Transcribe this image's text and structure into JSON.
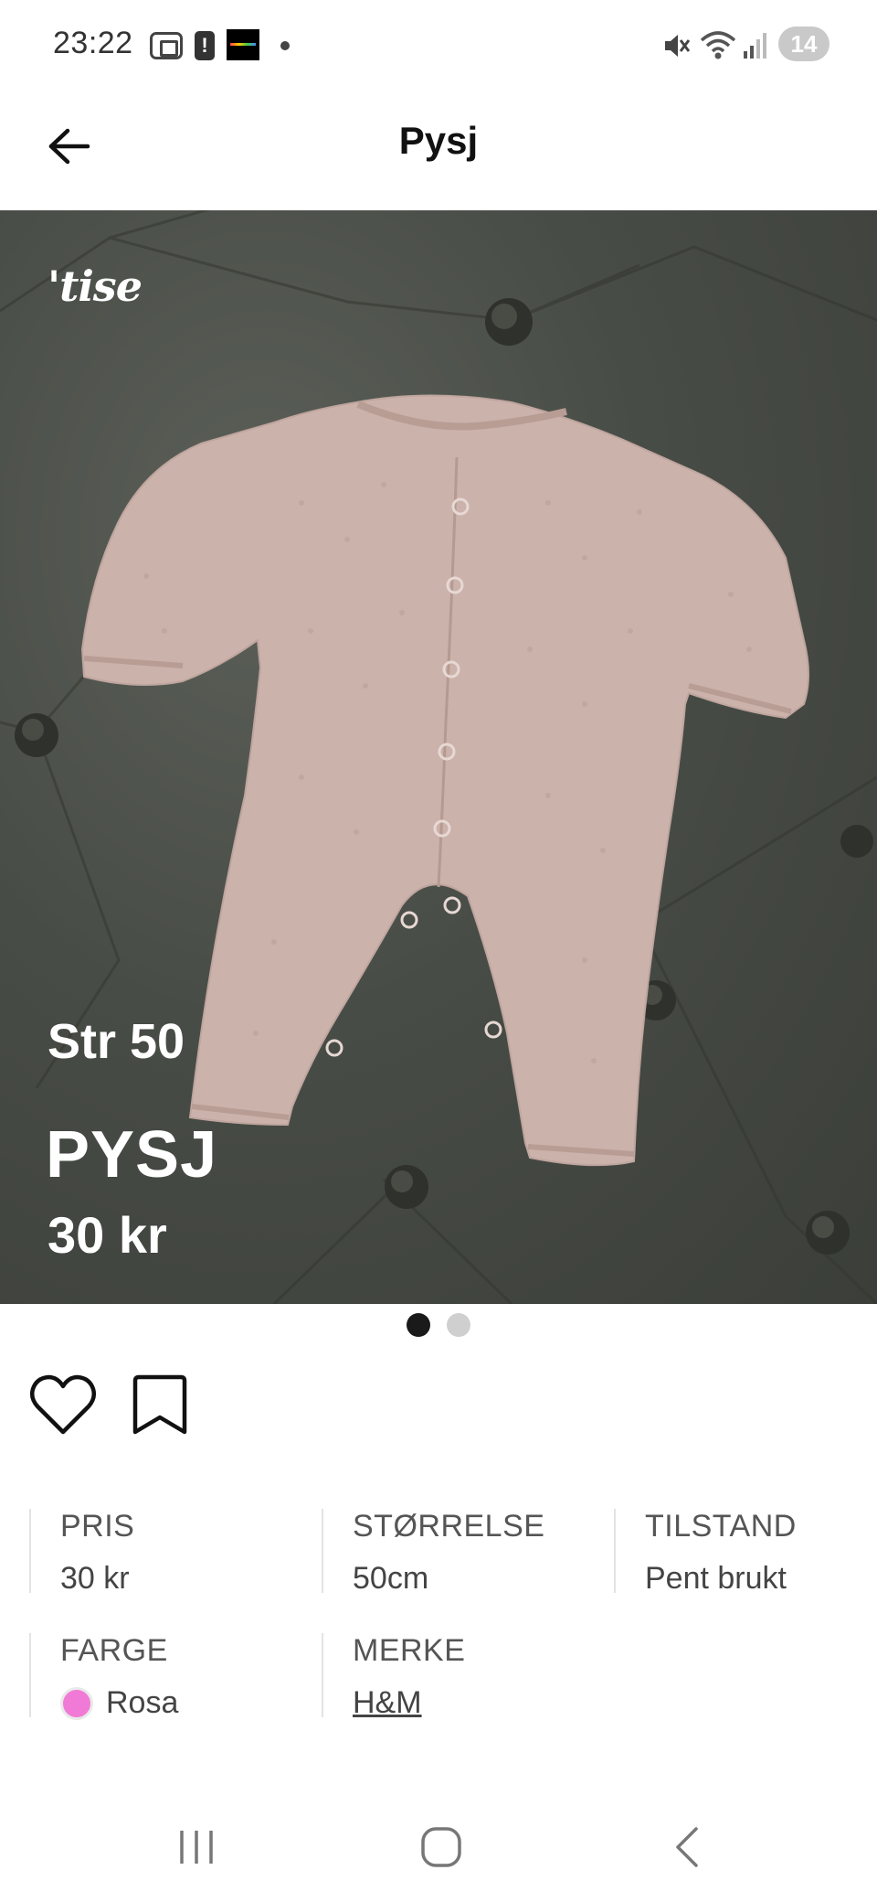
{
  "status_bar": {
    "time": "23:22",
    "battery": "14",
    "alert_symbol": "!",
    "icons": [
      "screenshot-icon",
      "alert-icon",
      "app-notification-icon",
      "more-dot-icon",
      "mute-icon",
      "wifi-icon",
      "signal-icon",
      "battery-icon"
    ]
  },
  "header": {
    "title": "Pysj",
    "back_icon": "arrow-left-icon"
  },
  "hero": {
    "watermark": "'tise",
    "overlay_size": "Str 50",
    "overlay_name": "PYSJ",
    "overlay_price": "30 kr"
  },
  "pager": {
    "total": 2,
    "active": 1
  },
  "actions": {
    "like_icon": "heart-icon",
    "save_icon": "bookmark-icon"
  },
  "attributes": [
    {
      "label": "PRIS",
      "value": "30 kr"
    },
    {
      "label": "STØRRELSE",
      "value": "50cm"
    },
    {
      "label": "TILSTAND",
      "value": "Pent brukt"
    },
    {
      "label": "FARGE",
      "value": "Rosa",
      "swatch_color": "#f07ad6"
    },
    {
      "label": "MERKE",
      "value": "H&M"
    }
  ],
  "nav_bar": {
    "icons": [
      "recent-apps-icon",
      "home-icon",
      "back-icon"
    ]
  }
}
